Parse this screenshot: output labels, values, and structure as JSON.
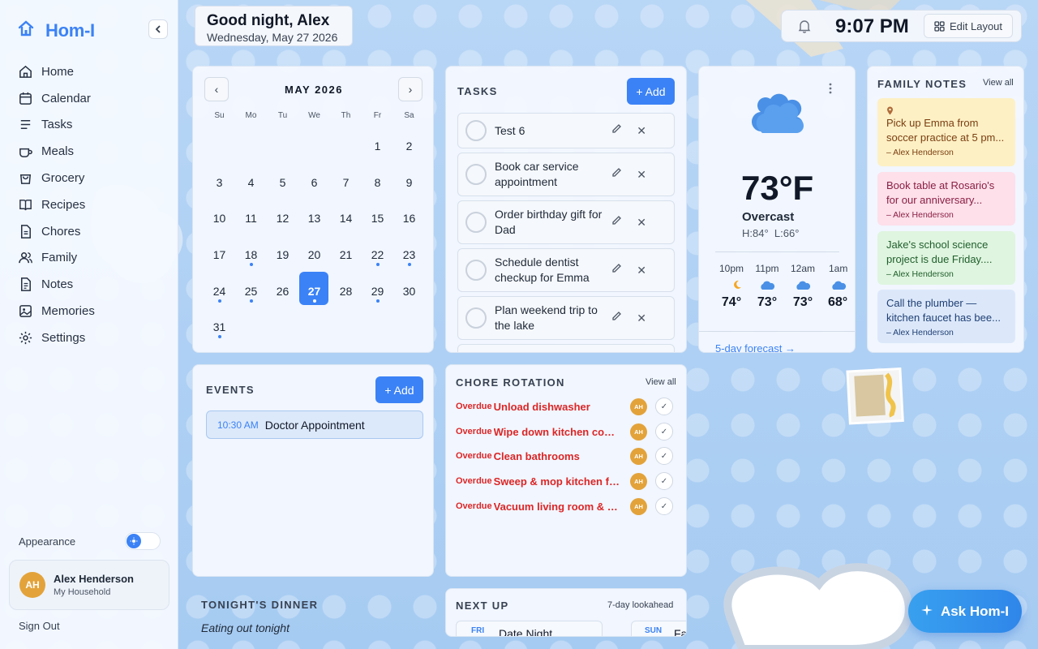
{
  "app": {
    "name": "Hom-I"
  },
  "sidebar": {
    "items": [
      {
        "label": "Home",
        "icon": "home-icon"
      },
      {
        "label": "Calendar",
        "icon": "calendar-icon"
      },
      {
        "label": "Tasks",
        "icon": "list-icon"
      },
      {
        "label": "Meals",
        "icon": "cup-icon"
      },
      {
        "label": "Grocery",
        "icon": "bag-icon"
      },
      {
        "label": "Recipes",
        "icon": "book-icon"
      },
      {
        "label": "Chores",
        "icon": "clipboard-icon"
      },
      {
        "label": "Family",
        "icon": "users-icon"
      },
      {
        "label": "Notes",
        "icon": "note-icon"
      },
      {
        "label": "Memories",
        "icon": "image-icon"
      },
      {
        "label": "Settings",
        "icon": "gear-icon"
      }
    ],
    "appearance_label": "Appearance",
    "profile": {
      "initials": "AH",
      "name": "Alex Henderson",
      "household": "My Household"
    },
    "signout_label": "Sign Out"
  },
  "greeting": {
    "title": "Good night, Alex",
    "date": "Wednesday, May 27 2026"
  },
  "topbar": {
    "time": "9:07 PM",
    "edit_label": "Edit Layout"
  },
  "calendar": {
    "month": "MAY 2026",
    "prev": "‹",
    "next": "›",
    "weekdays": [
      "Su",
      "Mo",
      "Tu",
      "We",
      "Th",
      "Fr",
      "Sa"
    ],
    "selected_day": 27,
    "days_with_events": [
      18,
      22,
      23,
      24,
      25,
      27,
      29,
      31
    ]
  },
  "tasks": {
    "title": "TASKS",
    "add_label": "+ Add",
    "items": [
      "Test 6",
      "Book car service appointment",
      "Order birthday gift for Dad",
      "Schedule dentist checkup for Emma",
      "Plan weekend trip to the lake"
    ]
  },
  "weather": {
    "temp": "73°F",
    "condition": "Overcast",
    "high": "H:84°",
    "low": "L:66°",
    "hourly": [
      {
        "time": "10pm",
        "temp": "74°",
        "icon": "moon-icon"
      },
      {
        "time": "11pm",
        "temp": "73°",
        "icon": "cloud-icon"
      },
      {
        "time": "12am",
        "temp": "73°",
        "icon": "cloud-icon"
      },
      {
        "time": "1am",
        "temp": "68°",
        "icon": "cloud-icon"
      }
    ],
    "forecast_link": "5-day forecast →"
  },
  "notes": {
    "title": "FAMILY NOTES",
    "view_all": "View all",
    "items": [
      {
        "text": "Pick up Emma from soccer practice at 5 pm...",
        "author": "– Alex Henderson",
        "color": "#fdf0c4",
        "text_color": "#7a3e12",
        "pinned": true
      },
      {
        "text": "Book table at Rosario's for our anniversary...",
        "author": "– Alex Henderson",
        "color": "#fde0ea",
        "text_color": "#8a1f44",
        "pinned": false
      },
      {
        "text": "Jake's school science project is due Friday....",
        "author": "– Alex Henderson",
        "color": "#dff5df",
        "text_color": "#1f5e2c",
        "pinned": false
      },
      {
        "text": "Call the plumber — kitchen faucet has bee...",
        "author": "– Alex Henderson",
        "color": "#dce8fa",
        "text_color": "#1f3f73",
        "pinned": false
      }
    ]
  },
  "events": {
    "title": "EVENTS",
    "add_label": "+ Add",
    "items": [
      {
        "time": "10:30 AM",
        "name": "Doctor Appointment"
      }
    ]
  },
  "chores": {
    "title": "CHORE ROTATION",
    "view_all": "View all",
    "items": [
      {
        "status": "Overdue",
        "name": "Unload dishwasher",
        "assignee": "AH"
      },
      {
        "status": "Overdue",
        "name": "Wipe down kitchen counters",
        "assignee": "AH"
      },
      {
        "status": "Overdue",
        "name": "Clean bathrooms",
        "assignee": "AH"
      },
      {
        "status": "Overdue",
        "name": "Sweep & mop kitchen floor",
        "assignee": "AH"
      },
      {
        "status": "Overdue",
        "name": "Vacuum living room & hallway",
        "assignee": "AH"
      }
    ]
  },
  "dinner": {
    "title": "TONIGHT'S DINNER",
    "text": "Eating out tonight"
  },
  "next_up": {
    "title": "NEXT UP",
    "range": "7-day lookahead",
    "items": [
      {
        "day": "FRI",
        "name": "Date Night"
      },
      {
        "day": "SUN",
        "name": "Farme"
      }
    ]
  },
  "ask_button": {
    "label": "Ask Hom-I"
  },
  "colors": {
    "accent": "#3b82f6",
    "overdue": "#dc2626",
    "avatar": "#e3a33a"
  }
}
